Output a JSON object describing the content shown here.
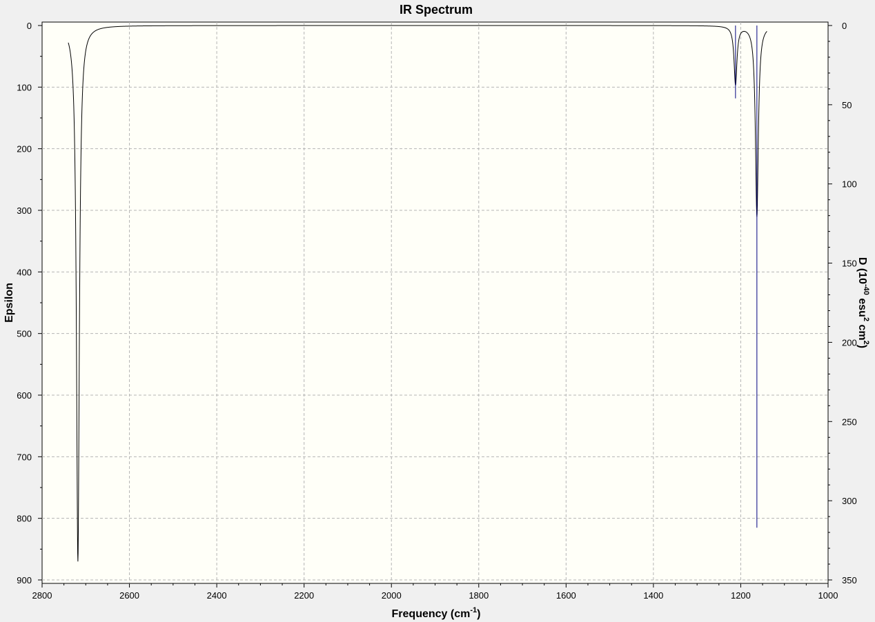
{
  "chart_data": {
    "type": "line",
    "title": "IR Spectrum",
    "xlabel": "Frequency (cm",
    "xlabel_sup": "-1",
    "xlabel_tail": ")",
    "ylabel": "Epsilon",
    "y2label_parts": [
      {
        "t": "D (10",
        "sup": false
      },
      {
        "t": "-40",
        "sup": true
      },
      {
        "t": " esu",
        "sup": false
      },
      {
        "t": "2",
        "sup": true
      },
      {
        "t": " cm",
        "sup": false
      },
      {
        "t": "2",
        "sup": true
      },
      {
        "t": ")",
        "sup": false
      }
    ],
    "xlim": [
      2800,
      1000
    ],
    "x_reversed": true,
    "ylim": [
      0,
      900
    ],
    "y_inverted": true,
    "y2lim": [
      0,
      350
    ],
    "grid": true,
    "x_ticks": [
      2800,
      2600,
      2400,
      2200,
      2000,
      1800,
      1600,
      1400,
      1200,
      1000
    ],
    "y_ticks": [
      0,
      100,
      200,
      300,
      400,
      500,
      600,
      700,
      800,
      900
    ],
    "y2_ticks": [
      0,
      50,
      100,
      150,
      200,
      250,
      300,
      350
    ],
    "curve_range": [
      2740,
      1140
    ],
    "peaks": [
      {
        "x": 2718,
        "epsilon": 870,
        "hwhm": 4
      },
      {
        "x": 1212,
        "epsilon": 95,
        "hwhm": 4
      },
      {
        "x": 1163,
        "epsilon": 310,
        "hwhm": 4
      }
    ],
    "series": [
      {
        "type": "line",
        "values": []
      },
      {
        "type": "stick",
        "values": [
          {
            "x": 2718,
            "D": 0
          },
          {
            "x": 1212,
            "D": 46
          },
          {
            "x": 1163,
            "D": 317
          }
        ]
      }
    ],
    "colors": {
      "spectrum": "#000000",
      "sticks": "#000080",
      "plot_bg": "#fffff8",
      "grid": "#b4b4b4",
      "page_bg": "#f0f0f0"
    }
  }
}
